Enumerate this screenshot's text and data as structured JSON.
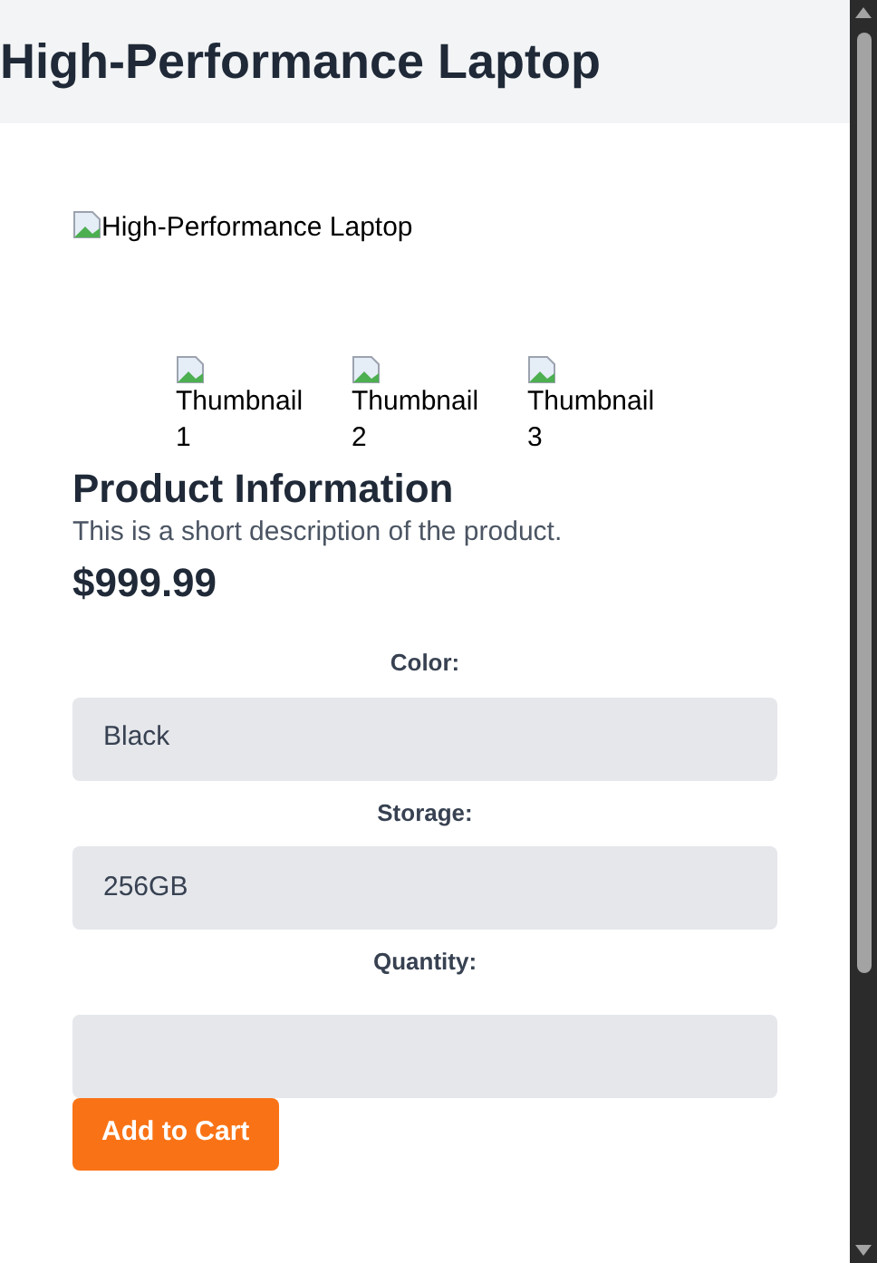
{
  "header": {
    "title": "High-Performance Laptop"
  },
  "main_image": {
    "alt": "High-Performance Laptop"
  },
  "thumbnails": [
    {
      "alt": "Thumbnail 1"
    },
    {
      "alt": "Thumbnail 2"
    },
    {
      "alt": "Thumbnail 3"
    }
  ],
  "product": {
    "heading": "Product Information",
    "description": "This is a short description of the product.",
    "price": "$999.99"
  },
  "fields": [
    {
      "kind": "select",
      "label": "Color:",
      "value": "Black"
    },
    {
      "kind": "select",
      "label": "Storage:",
      "value": "256GB"
    },
    {
      "kind": "number",
      "label": "Quantity:"
    }
  ],
  "button": {
    "label": "Add to Cart"
  }
}
